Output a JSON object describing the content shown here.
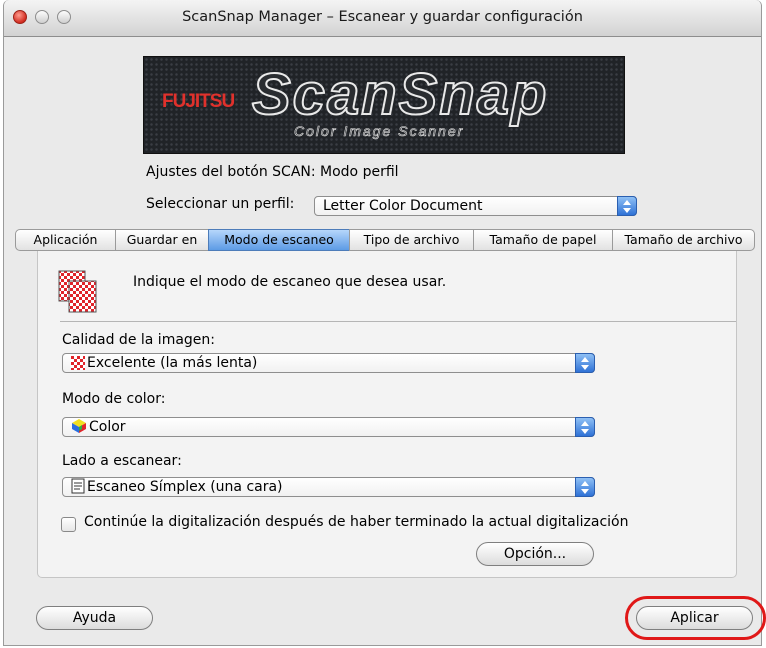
{
  "window": {
    "title": "ScanSnap Manager – Escanear y guardar configuración"
  },
  "logo": {
    "brand": "FUJITSU",
    "product": "ScanSnap",
    "tagline": "Color Image Scanner"
  },
  "header": {
    "scan_mode_text": "Ajustes del botón SCAN: Modo perfil",
    "profile_label": "Seleccionar un perfil:",
    "profile_value": "Letter Color Document"
  },
  "tabs": [
    {
      "label": "Aplicación",
      "active": false
    },
    {
      "label": "Guardar en",
      "active": false
    },
    {
      "label": "Modo de escaneo",
      "active": true
    },
    {
      "label": "Tipo de archivo",
      "active": false
    },
    {
      "label": "Tamaño de papel",
      "active": false
    },
    {
      "label": "Tamaño de archivo",
      "active": false
    }
  ],
  "panel": {
    "instruction": "Indique el modo de escaneo que desea usar.",
    "image_quality": {
      "label": "Calidad de la imagen:",
      "value": "Excelente (la más lenta)",
      "icon": "checker-red-icon"
    },
    "color_mode": {
      "label": "Modo de color:",
      "value": "Color",
      "icon": "color-cube-icon"
    },
    "scan_side": {
      "label": "Lado a escanear:",
      "value": "Escaneo Símplex (una cara)",
      "icon": "single-page-icon"
    },
    "continue_checkbox": {
      "label": "Continúe la digitalización después  de haber terminado la actual digitalización",
      "checked": false
    },
    "option_button": "Opción..."
  },
  "footer": {
    "help_button": "Ayuda",
    "apply_button": "Aplicar",
    "highlight_color": "#e01818"
  },
  "colors": {
    "tab_active": "#5d9be5",
    "popup_arrow": "#2f72d6"
  }
}
